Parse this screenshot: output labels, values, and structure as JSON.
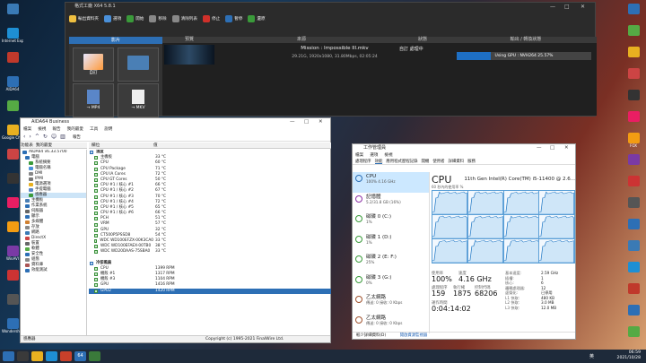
{
  "conv": {
    "title": "格式工廠 X64 5.8.1",
    "toolbar": [
      "輸出資料夾",
      "選項",
      "開始",
      "移除",
      "清除列表",
      "停止",
      "暫停",
      "還原"
    ],
    "left_header": "影片",
    "thumbs": [
      {
        "label": "自訂",
        "sub": ""
      },
      {
        "label": "",
        "sub": "影片"
      },
      {
        "label": "→ MP4",
        "sub": ""
      },
      {
        "label": "→ MKV",
        "sub": ""
      }
    ],
    "columns": [
      "預覽",
      "來源",
      "狀態",
      "輸出 / 轉換狀態"
    ],
    "job": {
      "name": "Mission : Impossible III.mkv",
      "meta": "29.21G, 1920x1080, 31.80Mbps, 02:05:24",
      "status": "自訂 處理中",
      "gpu": "Using GPU : NVH264 25.57%",
      "progress": 0.2557
    }
  },
  "aida": {
    "title": "AIDA64 Business",
    "menu": [
      "檔案",
      "檢視",
      "報告",
      "我的最愛",
      "工具",
      "說明"
    ],
    "toolbar": "報告",
    "cols": [
      "功能表",
      "我的最愛",
      "欄位",
      "值"
    ],
    "tree": [
      "AIDA64 v6.33.5700",
      "電腦",
      "系統摘要",
      "電腦名稱",
      "DMI",
      "IPMI",
      "電源選項",
      "手提電腦",
      "感應器",
      "主機板",
      "作業系統",
      "伺服器",
      "顯示",
      "多媒體",
      "存放",
      "網路",
      "DirectX",
      "裝置",
      "軟體",
      "安全性",
      "組態",
      "資料庫",
      "效能測試"
    ],
    "group_temp": "溫度",
    "temps": [
      [
        "主機板",
        "33 °C"
      ],
      [
        "CPU",
        "60 °C"
      ],
      [
        "CPU Package",
        "71 °C"
      ],
      [
        "CPU IA Cores",
        "72 °C"
      ],
      [
        "CPU GT Cores",
        "50 °C"
      ],
      [
        "CPU #1 / 核心 #1",
        "66 °C"
      ],
      [
        "CPU #1 / 核心 #2",
        "67 °C"
      ],
      [
        "CPU #1 / 核心 #3",
        "70 °C"
      ],
      [
        "CPU #1 / 核心 #4",
        "72 °C"
      ],
      [
        "CPU #1 / 核心 #5",
        "65 °C"
      ],
      [
        "CPU #1 / 核心 #6",
        "66 °C"
      ],
      [
        "PCH",
        "51 °C"
      ],
      [
        "VRM",
        "57 °C"
      ],
      [
        "GPU",
        "32 °C"
      ],
      [
        "CT500P5PSSD8",
        "54 °C"
      ],
      [
        "WDC WD100EFZX-00K3CA0",
        "33 °C"
      ],
      [
        "WDC WD100EFAEX-00TB0",
        "38 °C"
      ],
      [
        "WDC WD20DAAS-75SBA0",
        "33 °C"
      ]
    ],
    "group_fan": "冷卻風扇",
    "fans": [
      [
        "CPU",
        "1399 RPM"
      ],
      [
        "機殼 #1",
        "1317 RPM"
      ],
      [
        "機殼 #3",
        "1104 RPM"
      ],
      [
        "GPU",
        "1416 RPM"
      ],
      [
        "GPU2",
        "1420 RPM"
      ]
    ],
    "status_left": "感應器",
    "status_right": "Copyright (c) 1995-2021 FinalWire Ltd."
  },
  "tm": {
    "title": "工作管理員",
    "menu": [
      "檔案",
      "選項",
      "檢視"
    ],
    "tabs": [
      "處理程序",
      "效能",
      "應用程式歷程記錄",
      "開機",
      "使用者",
      "詳細資料",
      "服務"
    ],
    "side": [
      {
        "name": "CPU",
        "sub": "100% 4.16 GHz",
        "color": "#2d6fb5"
      },
      {
        "name": "記憶體",
        "sub": "5.2/31.8 GB (16%)",
        "color": "#8b2fa5"
      },
      {
        "name": "磁碟 0 (C:)",
        "sub": "1%",
        "color": "#3a9a3a"
      },
      {
        "name": "磁碟 1 (D:)",
        "sub": "1%",
        "color": "#3a9a3a"
      },
      {
        "name": "磁碟 2 (E: F:)",
        "sub": "25%",
        "color": "#3a9a3a"
      },
      {
        "name": "磁碟 3 (G:)",
        "sub": "0%",
        "color": "#3a9a3a"
      },
      {
        "name": "乙太網路",
        "sub": "傳送: 0 接收: 0 Kbps",
        "color": "#a0522d"
      },
      {
        "name": "乙太網路",
        "sub": "傳送: 0 接收: 0 Kbps",
        "color": "#a0522d"
      }
    ],
    "cpu_title": "CPU",
    "cpu_model": "11th Gen Intel(R) Core(TM) i5-11400 @ 2.6...",
    "cpu_chart_label": "60 秒內的使用率 %",
    "stats": {
      "util_label": "使用率",
      "util": "100%",
      "speed_label": "速度",
      "speed": "4.16 GHz",
      "proc_label": "處理程序",
      "proc": "159",
      "thr_label": "執行緒",
      "thr": "1875",
      "handles_label": "控制代碼",
      "handles": "68206",
      "uptime_label": "運作時間",
      "uptime": "0:04:14:02",
      "right": [
        [
          "基本速度:",
          "2.59 GHz"
        ],
        [
          "插槽:",
          "1"
        ],
        [
          "核心:",
          "6"
        ],
        [
          "邏輯處理器:",
          "12"
        ],
        [
          "虛擬化:",
          "已停用"
        ],
        [
          "L1 快取:",
          "480 KB"
        ],
        [
          "L2 快取:",
          "3.0 MB"
        ],
        [
          "L3 快取:",
          "12.0 MB"
        ]
      ]
    },
    "footer": "較少詳細資料(D)",
    "footer_link": "開啟資源監視器"
  },
  "taskbar": {
    "time": "06:59",
    "date": "2021/10/28",
    "lang": "英",
    "badge": "64"
  },
  "desktop_left": [
    "",
    "Internet Explorer",
    "",
    "AIDA64",
    "",
    "Google Chrome",
    "",
    "",
    "",
    "",
    "WinAVI",
    "",
    "",
    "Wondershare"
  ],
  "desktop_right": [
    "",
    "",
    "",
    "",
    "",
    "",
    "FOX",
    "",
    "",
    "",
    "",
    "",
    "",
    "",
    "",
    ""
  ]
}
